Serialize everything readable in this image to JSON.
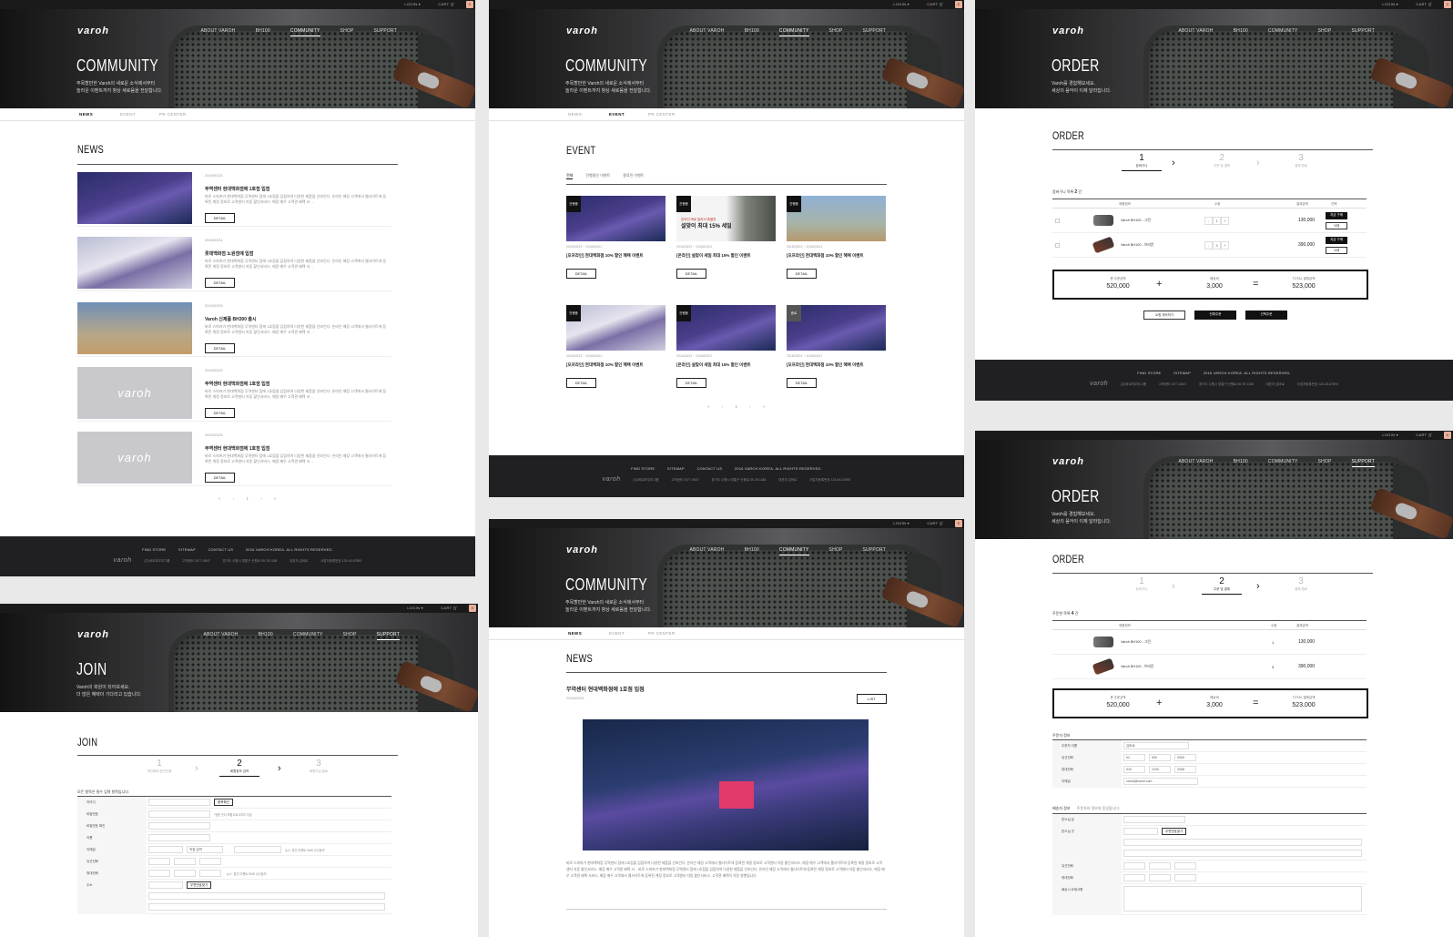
{
  "global": {
    "logo": "varoh",
    "nav": [
      "ABOUT VAROH",
      "BH100",
      "COMMUNITY",
      "SHOP",
      "SUPPORT"
    ],
    "util": {
      "login": "LOGIN ▾",
      "cart": "CART 🛒",
      "cart_count": "0"
    },
    "footer": {
      "links": [
        "FIND STORE",
        "SITEMAP",
        "CONTACT US",
        "2016 VAROH KOREA. ALL RIGHTS RESERVED."
      ],
      "info_logo": "varoh",
      "info": [
        "(주)바로하우리그룹",
        "고객센터 1577-0847",
        "경기도 수원시 영통구 신원로 55-78 1188",
        "대표자 김바로",
        "사업자등록번호 123-45-67890"
      ]
    },
    "sub_tabs": [
      "NEWS",
      "EVENT",
      "PR CENTER"
    ],
    "detail_label": "DETAIL",
    "pager": "« ‹ 1 › »"
  },
  "news": {
    "hero_title": "COMMUNITY",
    "hero_desc": "주목할만한 Varoh의 새로운 소식에서부터\n놀라운 이벤트까지 항상 새로움을 전달합니다.",
    "section_title": "NEWS",
    "items": [
      {
        "date": "2016/03/21",
        "title": "무역센터 현대백화점에 1호점 입점",
        "body": "바로 스피커가 현대백화점 무역센터 점에 1호점을 입점하여 다양한 제품을 선보인다. 온라인 매장 고객에서 웹사이트에 등록된 계정 정보로 고객센터 자동 할인서비스, 매장 매우 고객관 혜택 서 ..."
      },
      {
        "date": "2016/03/11",
        "title": "롯데백화점 노원점에 입점",
        "body": "바로 스피커가 현대백화점 무역센터 점에 1호점을 입점하여 다양한 제품을 선보인다. 온라인 매장 고객에서 웹사이트에 등록된 계정 정보로 고객센터 자동 할인서비스, 매장 매우 고객관 혜택 서 ..."
      },
      {
        "date": "2016/03/01",
        "title": "Varoh 신제품 BH300 출시",
        "body": "바로 스피커가 현대백화점 무역센터 점에 1호점을 입점하여 다양한 제품을 선보인다. 온라인 매장 고객에서 웹사이트에 등록된 계정 정보로 고객센터 자동 할인서비스, 매장 매우 고객관 혜택 서 ..."
      },
      {
        "date": "2016/03/21",
        "title": "무역센터 현대백화점에 1호점 입점",
        "body": "바로 스피커가 현대백화점 무역센터 점에 1호점을 입점하여 다양한 제품을 선보인다. 온라인 매장 고객에서 웹사이트에 등록된 계정 정보로 고객센터 자동 할인서비스, 매장 매우 고객관 혜택 서 ..."
      },
      {
        "date": "2016/03/21",
        "title": "무역센터 현대백화점에 1호점 입점",
        "body": "바로 스피커가 현대백화점 무역센터 점에 1호점을 입점하여 다양한 제품을 선보인다. 온라인 매장 고객에서 웹사이트에 등록된 계정 정보로 고객센터 자동 할인서비스, 매장 매우 고객관 혜택 서 ..."
      }
    ],
    "placeholder_logo": "varoh"
  },
  "event": {
    "hero_title": "COMMUNITY",
    "hero_desc": "주목할만한 Varoh의 새로운 소식에서부터\n놀라운 이벤트까지 항상 새로움을 전달합니다.",
    "section_title": "EVENT",
    "filters": [
      "전체",
      "진행중인 이벤트",
      "종료된 이벤트"
    ],
    "cards": [
      {
        "tag": "진행중",
        "date": "2016/03/21 ~ 2016/04/01",
        "title": "[오프라인] 현대백화점 10% 할인 혜택 이벤트"
      },
      {
        "tag": "진행중",
        "date": "2016/03/21 ~ 2016/04/01",
        "title": "[온라인] 설맞이 세일 최대 15% 할인 이벤트",
        "sale_line1": "온라인 바로 일러서 특별전",
        "sale_line2": "설맞이 최대 15% 세일"
      },
      {
        "tag": "진행중",
        "date": "2016/03/21 ~ 2016/04/01",
        "title": "[오프라인] 현대백화점 10% 할인 혜택 이벤트"
      },
      {
        "tag": "진행중",
        "date": "2016/03/21 ~ 2016/04/01",
        "title": "[오프라인] 현대백화점 10% 할인 혜택 이벤트"
      },
      {
        "tag": "진행중",
        "date": "2016/03/21 ~ 2016/04/01",
        "title": "[온라인] 설맞이 세일 최대 15% 할인 이벤트"
      },
      {
        "tag": "종료",
        "date": "2016/03/21 ~ 2016/04/01",
        "title": "[오프라인] 현대백화점 10% 할인 혜택 이벤트"
      }
    ]
  },
  "detail": {
    "hero_title": "COMMUNITY",
    "hero_desc": "주목할만한 Varoh의 새로운 소식에서부터\n놀라운 이벤트까지 항상 새로움을 전달합니다.",
    "section_title": "NEWS",
    "title": "무역센터 현대백화점에 1호점 입점",
    "date": "2016/03/21",
    "list_label": "LIST",
    "body": "바로 스피커가 현대백화점 무역센터 점에 1호점을 입점하여 다양한 제품을 선보인다. 온라인 매장 고객에서 웹사이트에 등록된 계정 정보로 고객센터 자동 할인서비스, 매장 매우 고객에서 웹사이트에 등록된 계정 정보로 고객센터 자동 할인서비스, 매장 매우 고객관 혜택 서 ...바로 스피커가 현대백화점 무역센터 점에 1호점을 입점하여 다양한 제품을 선보인다. 온라인 매장 고객에서 웹사이트에 등록된 계정 정보로 고객센터 자동 할인서비스, 매장 매우 고객관 혜택 서비스, 매장 매우 고객에서 웹사이트에 등록된 계정 정보로 고객센터 자동 할인서비스, 고객관 혜택이 자동 발행됩니다."
  },
  "join": {
    "hero_title": "JOIN",
    "hero_desc": "Varoh의 회원이 되어보세요.\n더 많은 혜택이 기다리고 있습니다.",
    "section_title": "JOIN",
    "steps": [
      {
        "num": "1",
        "label": "약관동의/본인인증"
      },
      {
        "num": "2",
        "label": "회원정보 입력"
      },
      {
        "num": "3",
        "label": "회원가입 완료"
      }
    ],
    "form_note": "모든 항목은 필수 입력 항목입니다.",
    "rows": [
      "아이디",
      "비밀번호",
      "비밀번호 확인",
      "이름",
      "이메일",
      "유선전화",
      "휴대전화",
      "주소"
    ],
    "dup_check": "중복확인",
    "pw_note": "*영문 숫자 조합으로 8자리 이상",
    "email_select": "직접 입력",
    "email_sms": "뉴스, 할인 이벤트 SMS 수신동의",
    "sms_note": "뉴스, 할인 이벤트 SMS 수신동의",
    "zip_btn": "우편번호찾기"
  },
  "order1": {
    "hero_title": "ORDER",
    "hero_desc": "Varoh를 경험해보세요.\n세상의 음악이 이제 달라집니다.",
    "section_title": "ORDER",
    "steps": [
      {
        "num": "1",
        "label": "장바구니"
      },
      {
        "num": "2",
        "label": "주문 및 결제"
      },
      {
        "num": "3",
        "label": "결제 완료"
      }
    ],
    "cart_label": "장바구니 목록",
    "cart_count": "2",
    "cart_unit": "건",
    "headers": [
      "제품정보",
      "수량",
      "결제금액",
      "선택"
    ],
    "items": [
      {
        "name": "Varoh BH100 - 그린",
        "qty": "1",
        "price": "130,000"
      },
      {
        "name": "Varoh BH100 - 브라운",
        "qty": "3",
        "price": "390,000"
      }
    ],
    "buy_now": "지금 구매",
    "delete": "삭제",
    "summary": {
      "total_label": "총 주문금액",
      "total": "520,000",
      "ship_label": "배송비",
      "ship": "3,000",
      "pay_label": "TOTAL 결제금액",
      "pay": "523,000"
    },
    "buttons": [
      "쇼핑 계속하기",
      "전체주문",
      "선택주문"
    ]
  },
  "order2": {
    "hero_title": "ORDER",
    "hero_desc": "Varoh를 경험해보세요.\n세상의 음악이 이제 달라집니다.",
    "section_title": "ORDER",
    "steps": [
      {
        "num": "1",
        "label": "장바구니"
      },
      {
        "num": "2",
        "label": "주문 및 결제"
      },
      {
        "num": "3",
        "label": "결제 완료"
      }
    ],
    "order_label": "주문한 목록",
    "order_count": "4",
    "order_unit": "건",
    "headers": [
      "제품정보",
      "수량",
      "결제금액"
    ],
    "items": [
      {
        "name": "Varoh BH100 - 그린",
        "qty": "1",
        "price": "130,000"
      },
      {
        "name": "Varoh BH100 - 브라운",
        "qty": "3",
        "price": "390,000"
      }
    ],
    "summary": {
      "total_label": "총 주문금액",
      "total": "520,000",
      "ship_label": "배송비",
      "ship": "3,000",
      "pay_label": "TOTAL 결제금액",
      "pay": "523,000"
    },
    "orderer_title": "주문자 정보",
    "orderer_rows": [
      {
        "label": "주문자 이름",
        "value": "김바로"
      },
      {
        "label": "유선전화",
        "v1": "02",
        "v2": "900",
        "v3": "0000"
      },
      {
        "label": "휴대전화",
        "v1": "010",
        "v2": "1234",
        "v3": "3408"
      },
      {
        "label": "이메일",
        "value": "varoh@naver.com"
      }
    ],
    "ship_title": "배송지 정보",
    "ship_same": "주문자와 정보와 동일합니다.",
    "ship_rows": [
      "받으실 분",
      "받으실 곳",
      "유선전화",
      "휴대전화",
      "배송시 요청사항"
    ],
    "zip_btn": "우편번호찾기"
  }
}
